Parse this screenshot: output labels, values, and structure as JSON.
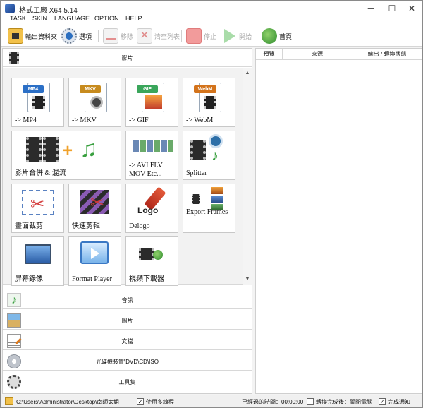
{
  "window": {
    "title": "格式工廠 X64 5.14"
  },
  "titlebar_buttons": {
    "minimize": "─",
    "maximize": "☐",
    "close": "✕"
  },
  "menu": [
    "TASK",
    "SKIN",
    "LANGUAGE",
    "OPTION",
    "HELP"
  ],
  "toolbar": {
    "output_folder": "輸出資料夾",
    "options": "選項",
    "remove": "移除",
    "clear_list": "清空列表",
    "stop": "停止",
    "start": "開始",
    "home": "首頁"
  },
  "categories": {
    "video": "影片",
    "audio": "音訊",
    "image": "圖片",
    "document": "文檔",
    "rom": "光碟機裝置\\DVD\\CD\\ISO",
    "tools": "工具集"
  },
  "tiles": [
    {
      "line1": "-> MP4",
      "line2": "",
      "icon": "mp4-file-icon",
      "tag": "MP4",
      "color": "#2b6fc6"
    },
    {
      "line1": "-> MKV",
      "line2": "",
      "icon": "mkv-file-icon",
      "tag": "MKV",
      "color": "#c78b1e"
    },
    {
      "line1": "-> GIF",
      "line2": "",
      "icon": "gif-file-icon",
      "tag": "GIF",
      "color": "#3aa65b"
    },
    {
      "line1": "-> WebM",
      "line2": "",
      "icon": "webm-file-icon",
      "tag": "WebM",
      "color": "#d3731b"
    },
    {
      "line1": "影片合併 & 混流",
      "line2": "",
      "icon": "video-join-mux-icon"
    },
    {
      "line1": "-> AVI FLV",
      "line2": "MOV Etc...",
      "icon": "other-formats-icon"
    },
    {
      "line1": "Splitter",
      "line2": "",
      "icon": "splitter-icon"
    },
    {
      "line1": "畫面裁剪",
      "line2": "",
      "icon": "crop-icon"
    },
    {
      "line1": "快速剪輯",
      "line2": "",
      "icon": "quick-clip-icon"
    },
    {
      "line1": "Delogo",
      "line2": "",
      "icon": "delogo-icon",
      "logo_text": "Logo"
    },
    {
      "line1": "Export Frames",
      "line2": "",
      "icon": "export-frames-icon"
    },
    {
      "line1": "屏幕錄像",
      "line2": "",
      "icon": "screen-record-icon"
    },
    {
      "line1": "Format Player",
      "line2": "",
      "icon": "format-player-icon"
    },
    {
      "line1": "視頻下載器",
      "line2": "",
      "icon": "video-downloader-icon"
    }
  ],
  "task_table": {
    "columns": [
      "預覽",
      "來源",
      "輸出 / 轉換狀態"
    ]
  },
  "statusbar": {
    "output_path": "C:\\Users\\Administrator\\Desktop\\南師太姐",
    "multithread_label": "使用多線程",
    "multithread_checked": true,
    "elapsed_label": "已經過的時間：00:00:00",
    "after_convert_label": "轉換完成後：關閉電腦",
    "after_convert_checked": false,
    "notify_label": "完成通知",
    "notify_checked": true
  }
}
